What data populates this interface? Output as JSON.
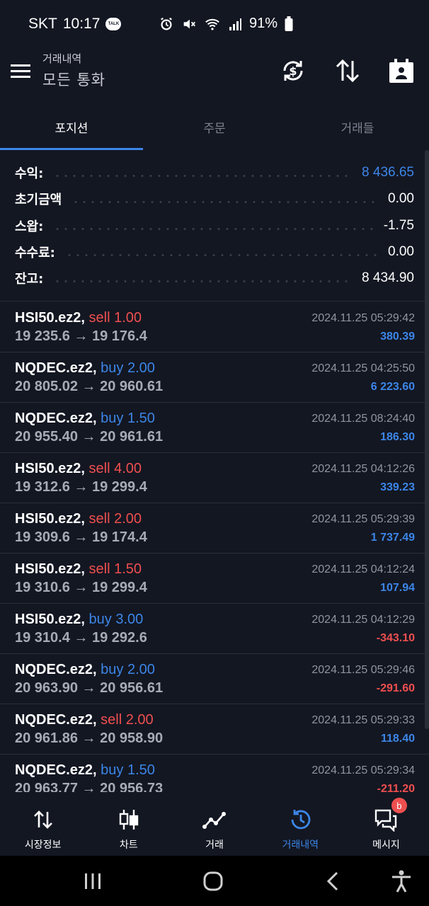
{
  "status_bar": {
    "carrier": "SKT",
    "time": "10:17",
    "talk_badge": "TALK",
    "battery": "91%"
  },
  "app_bar": {
    "title_small": "거래내역",
    "title_big": "모든 통화"
  },
  "tabs": [
    {
      "label": "포지션",
      "active": true
    },
    {
      "label": "주문",
      "active": false
    },
    {
      "label": "거래들",
      "active": false
    }
  ],
  "summary": [
    {
      "label": "수익:",
      "value": "8 436.65",
      "highlight": true
    },
    {
      "label": "초기금액",
      "value": "0.00",
      "highlight": false
    },
    {
      "label": "스왑:",
      "value": "-1.75",
      "highlight": false
    },
    {
      "label": "수수료:",
      "value": "0.00",
      "highlight": false
    },
    {
      "label": "잔고:",
      "value": "8 434.90",
      "highlight": false
    }
  ],
  "trades": [
    {
      "symbol": "HSI50.ez2,",
      "side": "sell 1.00",
      "side_type": "sell",
      "prices": "19 235.6 → 19 176.4",
      "date": "2024.11.25 05:29:42",
      "profit": "380.39",
      "profit_type": "pos"
    },
    {
      "symbol": "NQDEC.ez2,",
      "side": "buy 2.00",
      "side_type": "buy",
      "prices": "20 805.02 → 20 960.61",
      "date": "2024.11.25 04:25:50",
      "profit": "6 223.60",
      "profit_type": "pos"
    },
    {
      "symbol": "NQDEC.ez2,",
      "side": "buy 1.50",
      "side_type": "buy",
      "prices": "20 955.40 → 20 961.61",
      "date": "2024.11.25 08:24:40",
      "profit": "186.30",
      "profit_type": "pos"
    },
    {
      "symbol": "HSI50.ez2,",
      "side": "sell 4.00",
      "side_type": "sell",
      "prices": "19 312.6 → 19 299.4",
      "date": "2024.11.25 04:12:26",
      "profit": "339.23",
      "profit_type": "pos"
    },
    {
      "symbol": "HSI50.ez2,",
      "side": "sell 2.00",
      "side_type": "sell",
      "prices": "19 309.6 → 19 174.4",
      "date": "2024.11.25 05:29:39",
      "profit": "1 737.49",
      "profit_type": "pos"
    },
    {
      "symbol": "HSI50.ez2,",
      "side": "sell 1.50",
      "side_type": "sell",
      "prices": "19 310.6 → 19 299.4",
      "date": "2024.11.25 04:12:24",
      "profit": "107.94",
      "profit_type": "pos"
    },
    {
      "symbol": "HSI50.ez2,",
      "side": "buy 3.00",
      "side_type": "buy",
      "prices": "19 310.4 → 19 292.6",
      "date": "2024.11.25 04:12:29",
      "profit": "-343.10",
      "profit_type": "neg"
    },
    {
      "symbol": "NQDEC.ez2,",
      "side": "buy 2.00",
      "side_type": "buy",
      "prices": "20 963.90 → 20 956.61",
      "date": "2024.11.25 05:29:46",
      "profit": "-291.60",
      "profit_type": "neg"
    },
    {
      "symbol": "NQDEC.ez2,",
      "side": "sell 2.00",
      "side_type": "sell",
      "prices": "20 961.86 → 20 958.90",
      "date": "2024.11.25 05:29:33",
      "profit": "118.40",
      "profit_type": "pos"
    },
    {
      "symbol": "NQDEC.ez2,",
      "side": "buy 1.50",
      "side_type": "buy",
      "prices": "20 963.77 → 20 956.73",
      "date": "2024.11.25 05:29:34",
      "profit": "-211.20",
      "profit_type": "neg"
    }
  ],
  "bottom_nav": [
    {
      "label": "시장정보",
      "icon": "updown-arrows-icon",
      "active": false
    },
    {
      "label": "차트",
      "icon": "candlestick-icon",
      "active": false
    },
    {
      "label": "거래",
      "icon": "line-chart-icon",
      "active": false
    },
    {
      "label": "거래내역",
      "icon": "history-icon",
      "active": true
    },
    {
      "label": "메시지",
      "icon": "chat-icon",
      "active": false,
      "badge": "b"
    }
  ],
  "colors": {
    "background": "#131722",
    "accent": "#3c86e8",
    "sell": "#ef4f4f",
    "buy": "#3c86e8"
  }
}
